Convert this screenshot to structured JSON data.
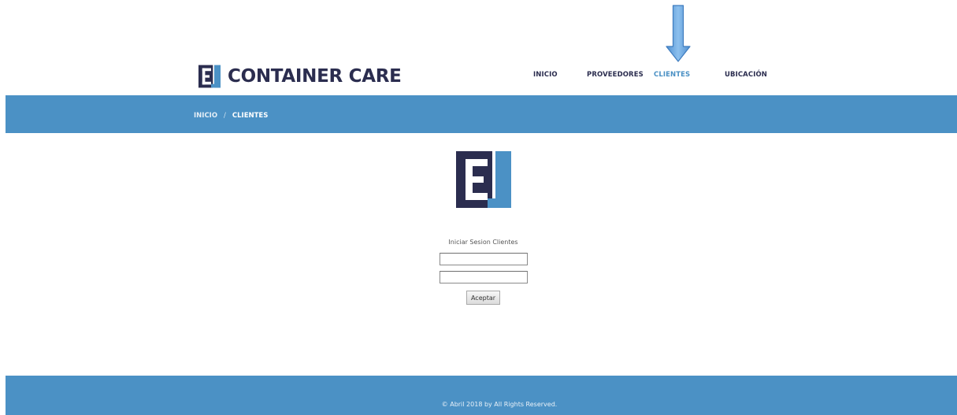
{
  "brand": {
    "name": "CONTAINER CARE",
    "logo_icon": "container-care-logo-icon",
    "colors": {
      "dark_navy": "#2b2d4f",
      "accent_blue": "#4b91c5",
      "active_link": "#4a90c4"
    }
  },
  "nav": {
    "items": [
      {
        "label": "INICIO",
        "active": false
      },
      {
        "label": "PROVEEDORES",
        "active": false
      },
      {
        "label": "CLIENTES",
        "active": true
      },
      {
        "label": "UBICACIÓN",
        "active": false
      }
    ]
  },
  "annotation": {
    "icon": "down-arrow-icon",
    "points_to": "CLIENTES"
  },
  "breadcrumb": {
    "home": "INICIO",
    "separator": "/",
    "current": "CLIENTES"
  },
  "login": {
    "title": "Iniciar Sesion Clientes",
    "username_value": "",
    "password_value": "",
    "submit_label": "Aceptar"
  },
  "footer": {
    "copyright": "© Abril 2018 by All Rights Reserved."
  }
}
